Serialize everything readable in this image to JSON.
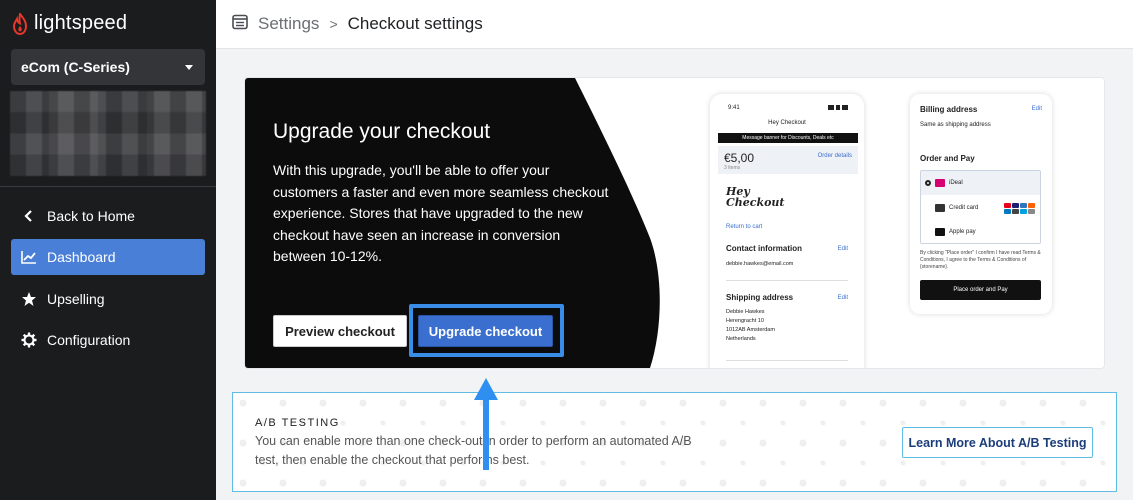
{
  "brand": {
    "name": "lightspeed",
    "color": "#e8372c"
  },
  "sidebar": {
    "store_select": "eCom (C-Series)",
    "items": [
      {
        "label": "Back to Home",
        "icon": "chevron-left-icon"
      },
      {
        "label": "Dashboard",
        "icon": "chart-line-icon",
        "active": true
      },
      {
        "label": "Upselling",
        "icon": "star-icon"
      },
      {
        "label": "Configuration",
        "icon": "gear-icon"
      }
    ],
    "active_color": "#4a7fd8"
  },
  "header": {
    "breadcrumb_parent": "Settings",
    "breadcrumb_separator": ">",
    "breadcrumb_current": "Checkout settings"
  },
  "banner": {
    "title": "Upgrade your checkout",
    "body": "With this upgrade, you'll be able to offer your customers a faster and even more seamless checkout experience. Stores that have upgraded to the new checkout have seen an increase in conversion between 10-12%.",
    "preview_button": "Preview checkout",
    "upgrade_button": "Upgrade checkout",
    "upgrade_color": "#3a6fd0"
  },
  "phone": {
    "time": "9:41",
    "title": "Hey Checkout",
    "message_banner": "Message banner for Discounts, Deals etc",
    "price": "€5,00",
    "items": "3 items",
    "order_details": "Order details",
    "logo_line1": "Hey",
    "logo_line2": "Checkout",
    "return_link": "Return to cart",
    "contact_heading": "Contact information",
    "edit": "Edit",
    "email": "debbie.hawkes@email.com",
    "shipping_heading": "Shipping address",
    "address": [
      "Debbie Hawkes",
      "Herengracht 10",
      "1012AB Amsterdam",
      "Netherlands"
    ]
  },
  "payment": {
    "billing_heading": "Billing address",
    "edit": "Edit",
    "billing_value": "Same as shipping address",
    "order_heading": "Order and Pay",
    "options": [
      "iDeal",
      "Credit card",
      "Apple pay"
    ],
    "terms": "By clicking \"Place order\" I confirm I have read Terms & Conditions, I agree to the Terms & Conditions of {storename}.",
    "button": "Place order and Pay"
  },
  "ab": {
    "title": "A/B TESTING",
    "text": "You can enable more than one check-out in order to perform an automated A/B test, then enable the checkout that performs best.",
    "button": "Learn More About A/B Testing",
    "border_color": "#5fbde5"
  }
}
